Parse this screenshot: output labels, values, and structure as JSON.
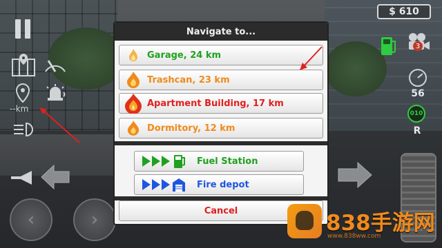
{
  "hud": {
    "money": "$ 610",
    "distance": "--km",
    "speed": "56",
    "gear_indicator": "010",
    "gear": "R",
    "camera_badge": "3"
  },
  "dialog": {
    "title": "Navigate to...",
    "destinations": [
      {
        "label": "Garage, 24 km",
        "color": "#1fa11f",
        "flame": "small"
      },
      {
        "label": "Trashcan, 23 km",
        "color": "#f08a1c",
        "flame": "medium"
      },
      {
        "label": "Apartment Building, 17 km",
        "color": "#e02020",
        "flame": "large"
      },
      {
        "label": "Dormitory, 12 km",
        "color": "#f08a1c",
        "flame": "medium"
      }
    ],
    "pois": [
      {
        "label": "Fuel Station",
        "color": "#1fa11f",
        "icon": "fuel-pump-icon"
      },
      {
        "label": "Fire depot",
        "color": "#1f56e0",
        "icon": "fire-station-icon"
      }
    ],
    "cancel_label": "Cancel",
    "cancel_color": "#e02020"
  },
  "watermark": {
    "text": "838手游网",
    "sub": "www.838ww.com"
  }
}
